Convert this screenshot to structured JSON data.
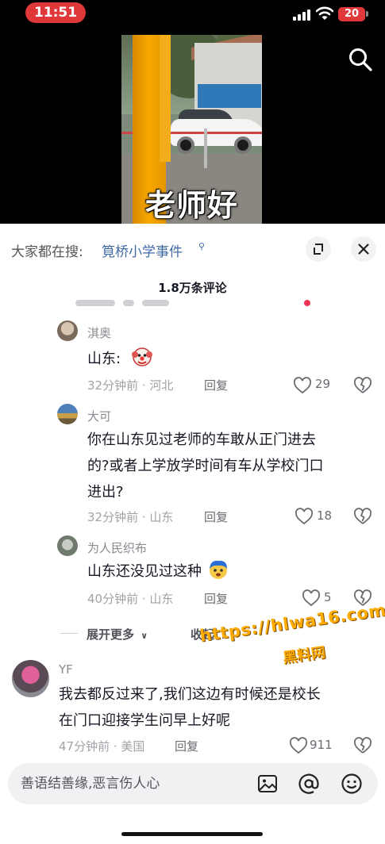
{
  "status_bar": {
    "time": "11:51",
    "battery": "20"
  },
  "video": {
    "caption": "老师好"
  },
  "sheet": {
    "search_prefix": "大家都在搜:",
    "search_term": "筧桥小学事件",
    "comment_count": "1.8万条评论"
  },
  "comments": [
    {
      "username": "淇奥",
      "text": "山东:",
      "emoji": "clown-face-icon",
      "meta": "32分钟前 · 河北",
      "reply": "回复",
      "likes": "29"
    },
    {
      "username": "大可",
      "text_lines": [
        "你在山东见过老师的车敢从正门进去",
        "的?或者上学放学时间有车从学校门口",
        "进出?"
      ],
      "meta": "32分钟前 · 山东",
      "reply": "回复",
      "likes": "18"
    },
    {
      "username": "为人民织布",
      "text": "山东还没见过这种",
      "emoji": "blue-hair-face-icon",
      "meta": "40分钟前 · 山东",
      "reply": "回复",
      "likes": "5"
    },
    {
      "username": "YF",
      "text_lines": [
        "我去都反过来了,我们这边有时候还是校长",
        "在门口迎接学生问早上好呢"
      ],
      "meta": "47分钟前 · 美国",
      "reply": "回复",
      "likes": "911"
    }
  ],
  "thread_controls": {
    "expand_more": "展开更多",
    "collapse": "收起"
  },
  "watermark": {
    "url": "https://hlwa16.com",
    "name": "黑料网"
  },
  "input": {
    "placeholder": "善语结善缘,恶言伤人心"
  },
  "colors": {
    "accent_link": "#3f6aa6",
    "time_pill": "#e0373a",
    "watermark": "#ffab00"
  }
}
